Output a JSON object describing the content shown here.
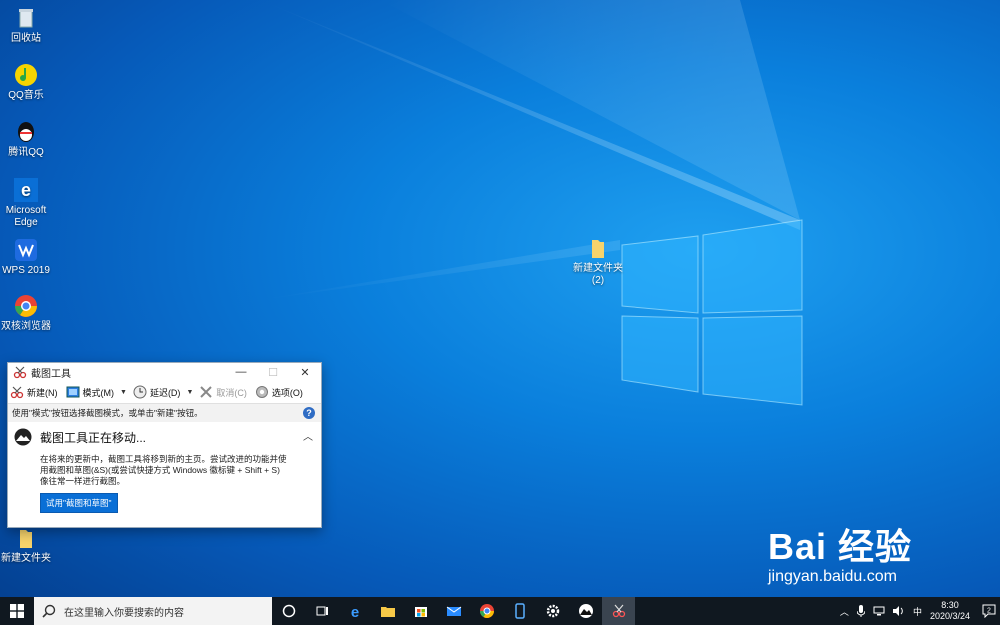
{
  "desktop": {
    "icons": [
      {
        "label": "回收站",
        "icon": "recycle-bin-icon"
      },
      {
        "label": "QQ音乐",
        "icon": "qq-music-icon"
      },
      {
        "label": "腾讯QQ",
        "icon": "qq-icon"
      },
      {
        "label": "Microsoft Edge",
        "icon": "edge-icon"
      },
      {
        "label": "WPS 2019",
        "icon": "wps-icon"
      },
      {
        "label": "双核浏览器",
        "icon": "browser-icon"
      },
      {
        "label": "新建文件夹",
        "icon": "folder-icon"
      },
      {
        "label": "新建文件夹 (2)",
        "icon": "folder-icon"
      }
    ]
  },
  "snipping_tool": {
    "title": "截图工具",
    "toolbar": {
      "new": "新建(N)",
      "mode": "模式(M)",
      "delay": "延迟(D)",
      "cancel": "取消(C)",
      "options": "选项(O)"
    },
    "hint": "使用\"模式\"按钮选择截图模式，或单击\"新建\"按钮。",
    "notice": {
      "title": "截图工具正在移动...",
      "body_line1": "在将来的更新中，截图工具将移到新的主页。尝试改进的功能并使",
      "body_line2": "用截图和草图(&S)(或尝试快捷方式 Windows 徽标键 + Shift + S)",
      "body_line3": "像往常一样进行截图。",
      "button": "试用\"截图和草图\""
    }
  },
  "taskbar": {
    "search_placeholder": "在这里输入你要搜索的内容",
    "ime": "中",
    "time": "8:30",
    "date": "2020/3/24",
    "notification_count": "2"
  },
  "watermark": {
    "brand": "Bai  经验",
    "url": "jingyan.baidu.com"
  },
  "colors": {
    "desktop_blue": "#0a7fdc",
    "taskbar": "#101820",
    "accent": "#0a6fd6"
  }
}
